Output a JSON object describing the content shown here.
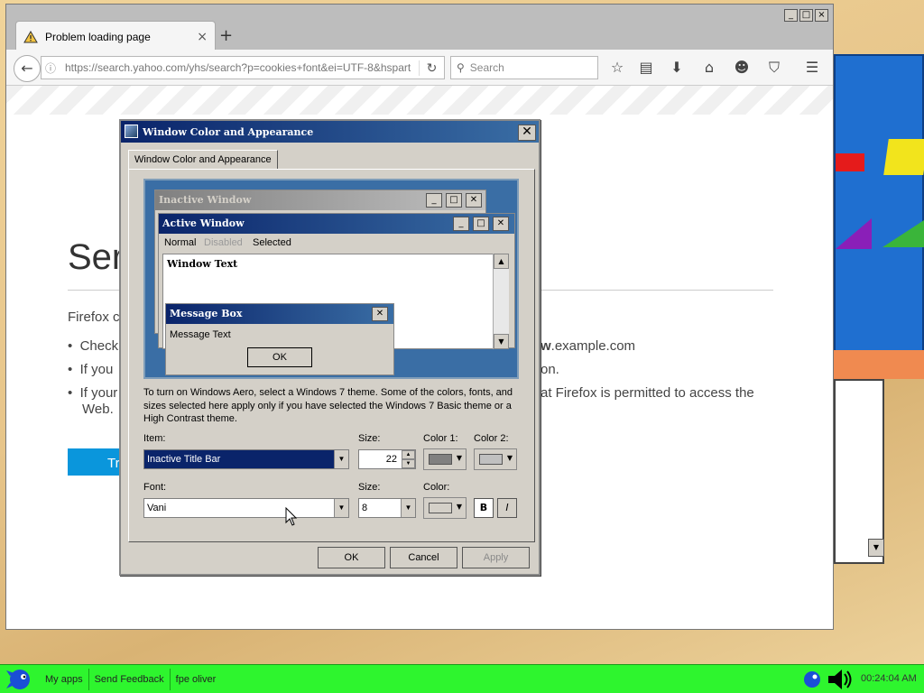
{
  "browser": {
    "tab_title": "Problem loading page",
    "tab_close": "×",
    "new_tab": "+",
    "window_buttons": [
      "_",
      "□",
      "×"
    ],
    "url": "https://search.yahoo.com/yhs/search?p=cookies+font&ei=UTF-8&hspart",
    "search_placeholder": "Search"
  },
  "error_page": {
    "title_partial": "Ser",
    "intro_partial": "Firefox c",
    "bullets": [
      {
        "start": "Check",
        "end_bold": "w",
        "end": ".example.com"
      },
      {
        "start": "If you",
        "end": "on."
      },
      {
        "start": "If your",
        "end": "at Firefox is permitted to access the",
        "second_line": "Web."
      }
    ],
    "button_partial": "Tr"
  },
  "dialog": {
    "title": "Window Color and Appearance",
    "tab_label": "Window Color and Appearance",
    "preview": {
      "inactive_title": "Inactive Window",
      "active_title": "Active Window",
      "menu": [
        "Normal",
        "Disabled",
        "Selected"
      ],
      "window_text": "Window Text",
      "msgbox_title": "Message Box",
      "msgbox_text": "Message Text",
      "msgbox_ok": "OK"
    },
    "aero_text": "To turn on Windows Aero, select a Windows 7 theme.  Some of the colors, fonts, and sizes selected here apply only if you have selected the Windows 7 Basic theme or a High Contrast theme.",
    "item_label": "Item:",
    "item_value": "Inactive Title Bar",
    "size_label": "Size:",
    "item_size": "22",
    "color1_label": "Color 1:",
    "color2_label": "Color 2:",
    "font_label": "Font:",
    "font_value": "Vani",
    "font_size_label": "Size:",
    "font_size": "8",
    "font_color_label": "Color:",
    "bold": "B",
    "italic": "I",
    "ok": "OK",
    "cancel": "Cancel",
    "apply": "Apply"
  },
  "taskbar": {
    "items": [
      "My apps",
      "Send Feedback",
      "fpe oliver"
    ],
    "clock": "00:24:04 AM"
  },
  "colors": {
    "taskbar": "#2ef52e",
    "title_active": "#0a246a",
    "title_inactive": "#808080",
    "try_again": "#0a96dc"
  }
}
